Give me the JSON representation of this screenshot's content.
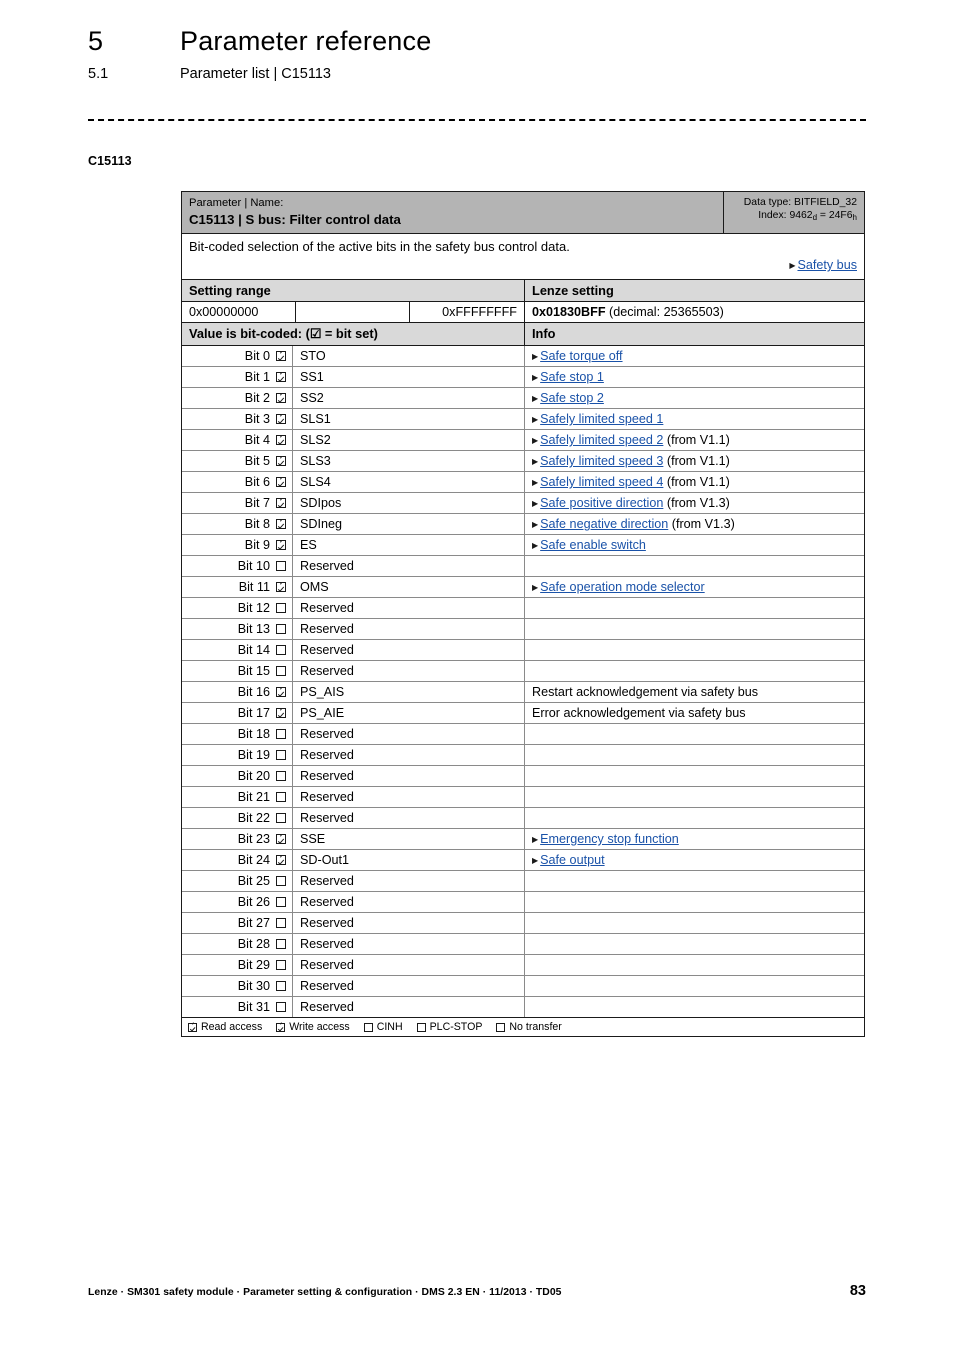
{
  "header": {
    "chapter_number": "5",
    "chapter_title": "Parameter reference",
    "section_number": "5.1",
    "section_title": "Parameter list | C15113"
  },
  "margin_tag": "C15113",
  "table": {
    "head": {
      "kicker": "Parameter | Name:",
      "name": "C15113 | S bus: Filter control data",
      "data_type_label": "Data type: BITFIELD_32",
      "index_label_prefix": "Index: ",
      "index_dec": "9462",
      "index_dec_sub": "d",
      "index_eq": " = ",
      "index_hex": "24F6",
      "index_hex_sub": "h"
    },
    "description": "Bit-coded selection of the active bits in the safety bus control data.",
    "description_link": "Safety bus",
    "setting_range_header": "Setting range",
    "lenze_setting_header": "Lenze setting",
    "range_min": "0x00000000",
    "range_mid": "",
    "range_max": "0xFFFFFFFF",
    "lenze_value": "0x01830BFF",
    "lenze_value_note": "(decimal: 25365503)",
    "bitcoded_header": "Value is bit-coded:  (☑ = bit set)",
    "info_header": "Info",
    "bits": [
      {
        "bit": "Bit 0",
        "set": true,
        "mnemonic": "STO",
        "link": "Safe torque off",
        "suffix": ""
      },
      {
        "bit": "Bit 1",
        "set": true,
        "mnemonic": "SS1",
        "link": "Safe stop 1",
        "suffix": ""
      },
      {
        "bit": "Bit 2",
        "set": true,
        "mnemonic": "SS2",
        "link": "Safe stop 2",
        "suffix": ""
      },
      {
        "bit": "Bit 3",
        "set": true,
        "mnemonic": "SLS1",
        "link": "Safely limited speed 1",
        "suffix": ""
      },
      {
        "bit": "Bit 4",
        "set": true,
        "mnemonic": "SLS2",
        "link": "Safely limited speed 2",
        "suffix": " (from V1.1)"
      },
      {
        "bit": "Bit 5",
        "set": true,
        "mnemonic": "SLS3",
        "link": "Safely limited speed 3",
        "suffix": " (from V1.1)"
      },
      {
        "bit": "Bit 6",
        "set": true,
        "mnemonic": "SLS4",
        "link": "Safely limited speed 4",
        "suffix": " (from V1.1)"
      },
      {
        "bit": "Bit 7",
        "set": true,
        "mnemonic": "SDIpos",
        "link": "Safe positive direction",
        "suffix": " (from V1.3)"
      },
      {
        "bit": "Bit 8",
        "set": true,
        "mnemonic": "SDIneg",
        "link": "Safe negative direction",
        "suffix": " (from V1.3)"
      },
      {
        "bit": "Bit 9",
        "set": true,
        "mnemonic": "ES",
        "link": "Safe enable switch",
        "suffix": ""
      },
      {
        "bit": "Bit 10",
        "set": false,
        "mnemonic": "Reserved",
        "link": "",
        "suffix": ""
      },
      {
        "bit": "Bit 11",
        "set": true,
        "mnemonic": "OMS",
        "link": "Safe operation mode selector",
        "suffix": ""
      },
      {
        "bit": "Bit 12",
        "set": false,
        "mnemonic": "Reserved",
        "link": "",
        "suffix": ""
      },
      {
        "bit": "Bit 13",
        "set": false,
        "mnemonic": "Reserved",
        "link": "",
        "suffix": ""
      },
      {
        "bit": "Bit 14",
        "set": false,
        "mnemonic": "Reserved",
        "link": "",
        "suffix": ""
      },
      {
        "bit": "Bit 15",
        "set": false,
        "mnemonic": "Reserved",
        "link": "",
        "suffix": ""
      },
      {
        "bit": "Bit 16",
        "set": true,
        "mnemonic": "PS_AIS",
        "link": "",
        "suffix": "",
        "text": "Restart acknowledgement via safety bus"
      },
      {
        "bit": "Bit 17",
        "set": true,
        "mnemonic": "PS_AIE",
        "link": "",
        "suffix": "",
        "text": "Error acknowledgement via safety bus"
      },
      {
        "bit": "Bit 18",
        "set": false,
        "mnemonic": "Reserved",
        "link": "",
        "suffix": ""
      },
      {
        "bit": "Bit 19",
        "set": false,
        "mnemonic": "Reserved",
        "link": "",
        "suffix": ""
      },
      {
        "bit": "Bit 20",
        "set": false,
        "mnemonic": "Reserved",
        "link": "",
        "suffix": ""
      },
      {
        "bit": "Bit 21",
        "set": false,
        "mnemonic": "Reserved",
        "link": "",
        "suffix": ""
      },
      {
        "bit": "Bit 22",
        "set": false,
        "mnemonic": "Reserved",
        "link": "",
        "suffix": ""
      },
      {
        "bit": "Bit 23",
        "set": true,
        "mnemonic": "SSE",
        "link": "Emergency stop function",
        "suffix": ""
      },
      {
        "bit": "Bit 24",
        "set": true,
        "mnemonic": "SD-Out1",
        "link": "Safe output",
        "suffix": ""
      },
      {
        "bit": "Bit 25",
        "set": false,
        "mnemonic": "Reserved",
        "link": "",
        "suffix": ""
      },
      {
        "bit": "Bit 26",
        "set": false,
        "mnemonic": "Reserved",
        "link": "",
        "suffix": ""
      },
      {
        "bit": "Bit 27",
        "set": false,
        "mnemonic": "Reserved",
        "link": "",
        "suffix": ""
      },
      {
        "bit": "Bit 28",
        "set": false,
        "mnemonic": "Reserved",
        "link": "",
        "suffix": ""
      },
      {
        "bit": "Bit 29",
        "set": false,
        "mnemonic": "Reserved",
        "link": "",
        "suffix": ""
      },
      {
        "bit": "Bit 30",
        "set": false,
        "mnemonic": "Reserved",
        "link": "",
        "suffix": ""
      },
      {
        "bit": "Bit 31",
        "set": false,
        "mnemonic": "Reserved",
        "link": "",
        "suffix": ""
      }
    ],
    "access": [
      {
        "label": "Read access",
        "set": true
      },
      {
        "label": "Write access",
        "set": true
      },
      {
        "label": "CINH",
        "set": false
      },
      {
        "label": "PLC-STOP",
        "set": false
      },
      {
        "label": "No transfer",
        "set": false
      }
    ]
  },
  "footer": {
    "text": "Lenze · SM301 safety module · Parameter setting & configuration · DMS 2.3 EN · 11/2013 · TD05",
    "page": "83"
  },
  "colors": {
    "link": "#1a52a8",
    "header_band": "#b4b4b4",
    "subheader_band": "#d9d9d9",
    "rule": "#1a1a1a"
  }
}
